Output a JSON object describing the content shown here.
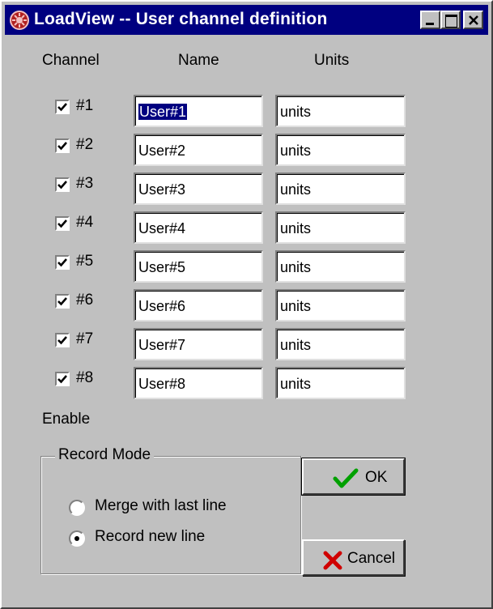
{
  "window": {
    "title": "LoadView -- User channel definition",
    "icon": "loadview-app-icon"
  },
  "headers": {
    "channel": "Channel",
    "name": "Name",
    "units": "Units"
  },
  "channels": [
    {
      "label": "#1",
      "enabled": true,
      "name": "User#1",
      "units": "units",
      "name_selected": true
    },
    {
      "label": "#2",
      "enabled": true,
      "name": "User#2",
      "units": "units"
    },
    {
      "label": "#3",
      "enabled": true,
      "name": "User#3",
      "units": "units"
    },
    {
      "label": "#4",
      "enabled": true,
      "name": "User#4",
      "units": "units"
    },
    {
      "label": "#5",
      "enabled": true,
      "name": "User#5",
      "units": "units"
    },
    {
      "label": "#6",
      "enabled": true,
      "name": "User#6",
      "units": "units"
    },
    {
      "label": "#7",
      "enabled": true,
      "name": "User#7",
      "units": "units"
    },
    {
      "label": "#8",
      "enabled": true,
      "name": "User#8",
      "units": "units"
    }
  ],
  "enable_label": "Enable",
  "record_mode": {
    "legend": "Record Mode",
    "options": [
      {
        "label": "Merge with last line",
        "selected": false
      },
      {
        "label": "Record new line",
        "selected": true
      }
    ]
  },
  "buttons": {
    "ok": {
      "label": "OK",
      "icon": "checkmark-icon",
      "icon_color": "#00a000"
    },
    "cancel": {
      "label": "Cancel",
      "icon": "x-cross-icon",
      "icon_color": "#d00000"
    }
  },
  "colors": {
    "face": "#c0c0c0",
    "titlebar": "#000080",
    "selection": "#000080"
  }
}
